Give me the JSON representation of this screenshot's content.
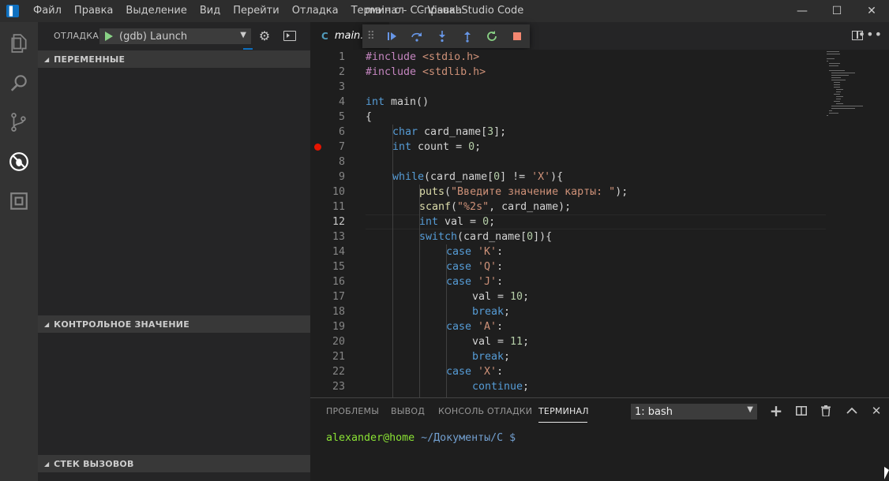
{
  "window": {
    "title": "main.c - C - Visual Studio Code",
    "minimize": "—",
    "maximize": "☐",
    "close": "✕"
  },
  "menu": [
    "Файл",
    "Правка",
    "Выделение",
    "Вид",
    "Перейти",
    "Отладка",
    "Терминал",
    "Справка"
  ],
  "sidebar": {
    "debug_label": "ОТЛАДКА",
    "config": "(gdb) Launch",
    "sections": {
      "variables": "ПЕРЕМЕННЫЕ",
      "watch": "КОНТРОЛЬНОЕ ЗНАЧЕНИЕ",
      "callstack": "СТЕК ВЫЗОВОВ"
    }
  },
  "editor": {
    "tab": "main.c",
    "tab_lang": "C",
    "active_line": 12,
    "breakpoint_line": 7,
    "lines": [
      {
        "n": "1"
      },
      {
        "n": "2"
      },
      {
        "n": "3"
      },
      {
        "n": "4"
      },
      {
        "n": "5"
      },
      {
        "n": "6"
      },
      {
        "n": "7"
      },
      {
        "n": "8"
      },
      {
        "n": "9"
      },
      {
        "n": "10"
      },
      {
        "n": "11"
      },
      {
        "n": "12"
      },
      {
        "n": "13"
      },
      {
        "n": "14"
      },
      {
        "n": "15"
      },
      {
        "n": "16"
      },
      {
        "n": "17"
      },
      {
        "n": "18"
      },
      {
        "n": "19"
      },
      {
        "n": "20"
      },
      {
        "n": "21"
      },
      {
        "n": "22"
      },
      {
        "n": "23"
      }
    ],
    "code": {
      "l1a": "#include",
      "l1b": " <stdio.h>",
      "l2a": "#include",
      "l2b": " <stdlib.h>",
      "l4a": "int",
      "l4b": " main()",
      "l5": "{",
      "l6a": "char",
      "l6b": " card_name[",
      "l6c": "3",
      "l6d": "];",
      "l7a": "int",
      "l7b": " count = ",
      "l7c": "0",
      "l7d": ";",
      "l9a": "while",
      "l9b": "(card_name[",
      "l9c": "0",
      "l9d": "] != ",
      "l9e": "'X'",
      "l9f": "){",
      "l10a": "puts",
      "l10b": "(",
      "l10c": "\"Введите значение карты: \"",
      "l10d": ");",
      "l11a": "scanf",
      "l11b": "(",
      "l11c": "\"%2s\"",
      "l11d": ", card_name);",
      "l12a": "int",
      "l12b": " val = ",
      "l12c": "0",
      "l12d": ";",
      "l13a": "switch",
      "l13b": "(card_name[",
      "l13c": "0",
      "l13d": "]){",
      "l14a": "case",
      "l14b": " ",
      "l14c": "'K'",
      "l14d": ":",
      "l15a": "case",
      "l15b": " ",
      "l15c": "'Q'",
      "l15d": ":",
      "l16a": "case",
      "l16b": " ",
      "l16c": "'J'",
      "l16d": ":",
      "l17a": "val = ",
      "l17b": "10",
      "l17c": ";",
      "l18a": "break",
      "l18b": ";",
      "l19a": "case",
      "l19b": " ",
      "l19c": "'A'",
      "l19d": ":",
      "l20a": "val = ",
      "l20b": "11",
      "l20c": ";",
      "l21a": "break",
      "l21b": ";",
      "l22a": "case",
      "l22b": " ",
      "l22c": "'X'",
      "l22d": ":",
      "l23a": "continue",
      "l23b": ";"
    }
  },
  "panel": {
    "tabs": [
      "ПРОБЛЕМЫ",
      "ВЫВОД",
      "КОНСОЛЬ ОТЛАДКИ",
      "ТЕРМИНАЛ"
    ],
    "active_tab": "ТЕРМИНАЛ",
    "terminal_select": "1: bash",
    "prompt_user": "alexander",
    "prompt_at": "@home",
    "prompt_path": " ~/Документы/C",
    "prompt_symbol": " $"
  },
  "colors": {
    "accent": "#0e70c0",
    "breakpoint": "#e51400",
    "play": "#89d185",
    "stop": "#f48771"
  }
}
